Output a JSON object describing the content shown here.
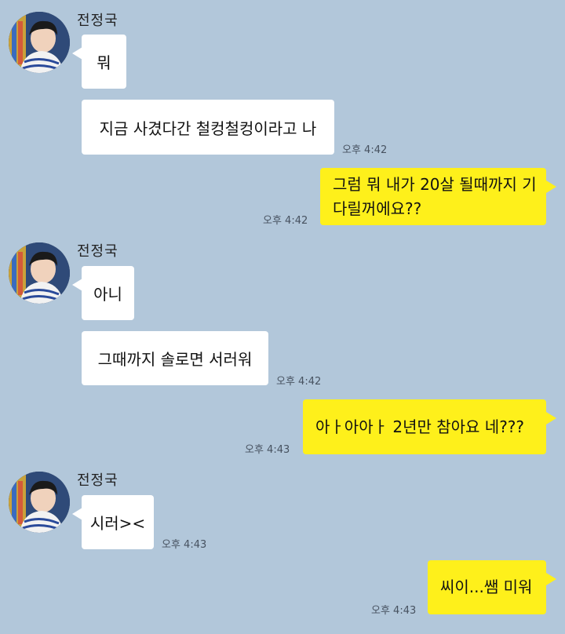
{
  "chat": {
    "sender_name": "전정국",
    "bg_color": "#b2c7da",
    "outgoing_color": "#fef01b",
    "incoming_color": "#ffffff",
    "groups": [
      {
        "type": "incoming",
        "name": "전정국",
        "avatar": "profile-photo",
        "messages": [
          {
            "text": "뭐"
          },
          {
            "text": "지금 사겼다간 철컹철컹이라고 나",
            "time": "오후 4:42"
          }
        ]
      },
      {
        "type": "outgoing",
        "messages": [
          {
            "text": "그럼 뭐 내가 20살 될때까지 기다릴꺼에요??",
            "time": "오후 4:42"
          }
        ]
      },
      {
        "type": "incoming",
        "name": "전정국",
        "avatar": "profile-photo",
        "messages": [
          {
            "text": "아니"
          },
          {
            "text": "그때까지 솔로면 서러워",
            "time": "오후 4:42"
          }
        ]
      },
      {
        "type": "outgoing",
        "messages": [
          {
            "text": "아ㅏ아아ㅏ 2년만 참아요 네???",
            "time": "오후 4:43"
          }
        ]
      },
      {
        "type": "incoming",
        "name": "전정국",
        "avatar": "profile-photo",
        "messages": [
          {
            "text": "시러><",
            "time": "오후 4:43"
          }
        ]
      },
      {
        "type": "outgoing",
        "messages": [
          {
            "text": "씨이...쌤 미워",
            "time": "오후 4:43"
          }
        ]
      }
    ]
  }
}
